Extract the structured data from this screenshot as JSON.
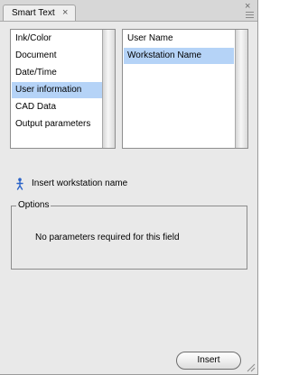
{
  "tab": {
    "title": "Smart Text",
    "close_glyph": "×"
  },
  "panel": {
    "close_glyph": "×"
  },
  "categories": {
    "items": [
      {
        "label": "Ink/Color"
      },
      {
        "label": "Document"
      },
      {
        "label": "Date/Time"
      },
      {
        "label": "User information"
      },
      {
        "label": "CAD Data"
      },
      {
        "label": "Output parameters"
      }
    ],
    "selected": "User information"
  },
  "fields": {
    "items": [
      {
        "label": "User Name"
      },
      {
        "label": "Workstation Name"
      }
    ],
    "selected": "Workstation Name"
  },
  "info": {
    "icon": "insert-person-icon",
    "text": "Insert workstation name"
  },
  "options": {
    "title": "Options",
    "message": "No parameters required for this field"
  },
  "insert_button": {
    "label": "Insert"
  },
  "colors": {
    "selection": "#b5d3f7",
    "panel_background": "#e9e9e9",
    "icon_blue": "#2a63c8"
  }
}
